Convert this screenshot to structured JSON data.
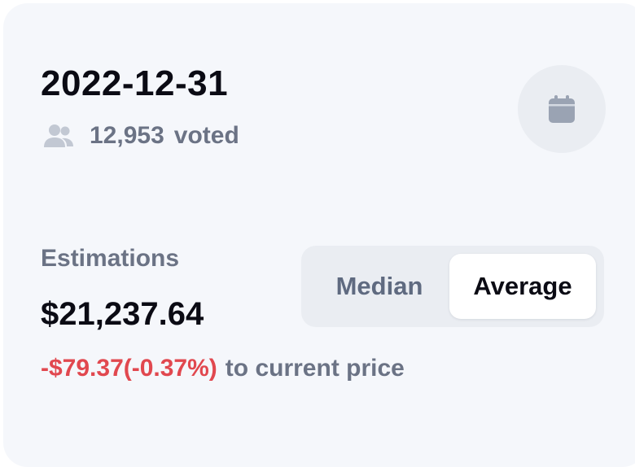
{
  "header": {
    "date": "2022-12-31",
    "votes_count": "12,953",
    "votes_label": "voted",
    "votes_icon": "users-icon",
    "calendar_icon": "calendar-icon"
  },
  "estimations": {
    "label": "Estimations",
    "value": "$21,237.64",
    "change": "-$79.37(-0.37%)",
    "change_suffix": "to current price",
    "toggle": {
      "options": [
        "Median",
        "Average"
      ],
      "selected": "Average"
    }
  },
  "colors": {
    "card_bg": "#f5f7fb",
    "primary_text": "#0b0b14",
    "muted_text": "#6b7385",
    "negative": "#e1484f",
    "toggle_bg": "#eaedf2",
    "icon": "#9aa3b3"
  }
}
